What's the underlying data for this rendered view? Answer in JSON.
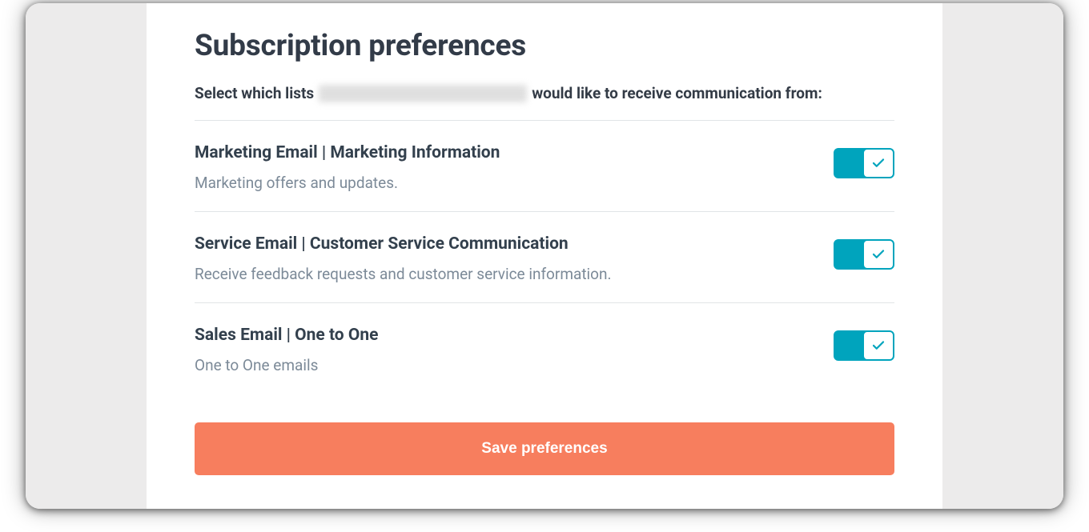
{
  "heading": "Subscription preferences",
  "subline_prefix": "Select which lists",
  "subline_suffix": "would like to receive communication from:",
  "items": [
    {
      "title": "Marketing Email | Marketing Information",
      "description": "Marketing offers and updates.",
      "enabled": true
    },
    {
      "title": "Service Email | Customer Service Communication",
      "description": "Receive feedback requests and customer service information.",
      "enabled": true
    },
    {
      "title": "Sales Email | One to One",
      "description": "One to One emails",
      "enabled": true
    }
  ],
  "save_label": "Save preferences",
  "colors": {
    "accent": "#00a4bd",
    "action": "#f77e5e",
    "heading": "#323b48",
    "muted": "#7c8a98"
  }
}
